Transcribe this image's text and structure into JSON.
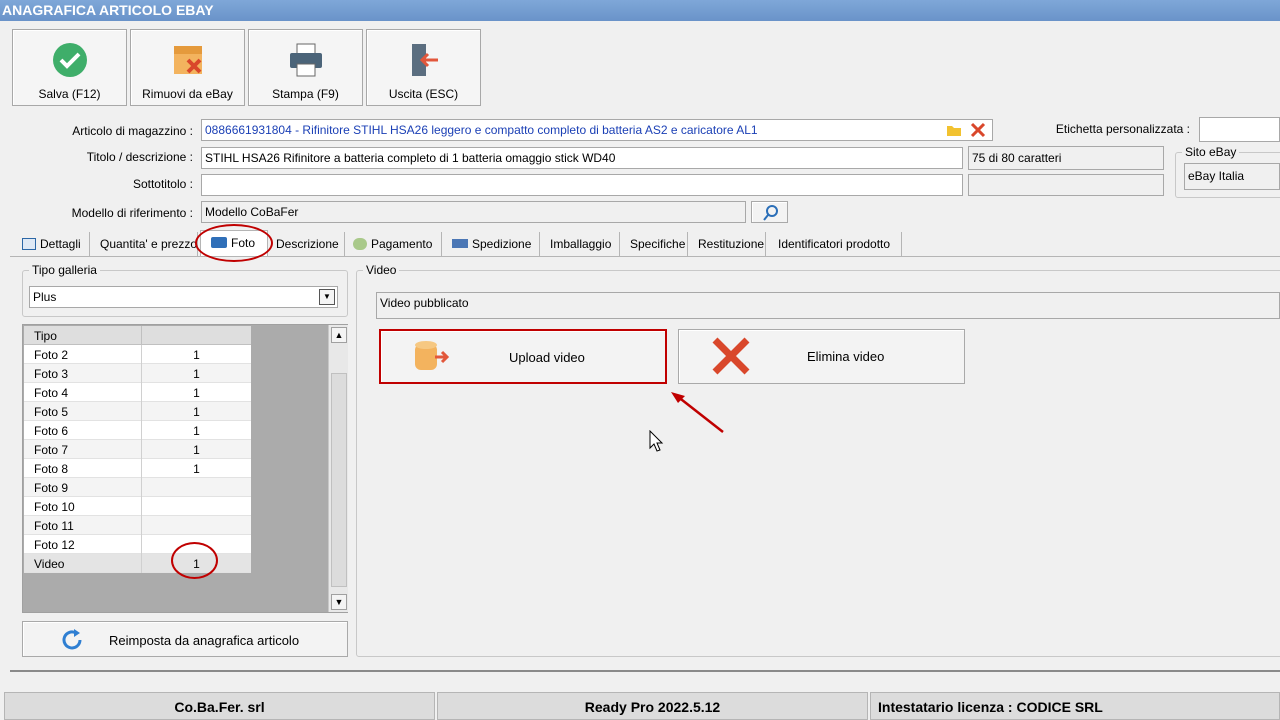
{
  "window": {
    "title": "ANAGRAFICA ARTICOLO EBAY"
  },
  "toolbar": {
    "save": "Salva (F12)",
    "remove": "Rimuovi da eBay",
    "print": "Stampa (F9)",
    "exit": "Uscita (ESC)"
  },
  "form": {
    "articolo_label": "Articolo di magazzino :",
    "articolo_value": "0886661931804 - Rifinitore STIHL HSA26 leggero e compatto completo di batteria AS2 e caricatore AL1",
    "titolo_label": "Titolo / descrizione :",
    "titolo_value": "STIHL HSA26 Rifinitore a batteria completo di 1 batteria omaggio stick WD40",
    "char_count": "75 di 80 caratteri",
    "sottotitolo_label": "Sottotitolo :",
    "sottotitolo_value": "",
    "modello_label": "Modello di riferimento :",
    "modello_value": "Modello CoBaFer",
    "etichetta_label": "Etichetta personalizzata :",
    "etichetta_value": "",
    "sito_label": "Sito eBay",
    "sito_value": "eBay Italia"
  },
  "tabs": [
    "Dettagli",
    "Quantita' e prezzo",
    "Foto",
    "Descrizione",
    "Pagamento",
    "Spedizione",
    "Imballaggio",
    "Specifiche",
    "Restituzione",
    "Identificatori prodotto"
  ],
  "gallery": {
    "group_title": "Tipo galleria",
    "selected": "Plus",
    "grid_header": "Tipo",
    "rows": [
      {
        "tipo": "Foto 2",
        "val": "1"
      },
      {
        "tipo": "Foto 3",
        "val": "1"
      },
      {
        "tipo": "Foto 4",
        "val": "1"
      },
      {
        "tipo": "Foto 5",
        "val": "1"
      },
      {
        "tipo": "Foto 6",
        "val": "1"
      },
      {
        "tipo": "Foto 7",
        "val": "1"
      },
      {
        "tipo": "Foto 8",
        "val": "1"
      },
      {
        "tipo": "Foto 9",
        "val": ""
      },
      {
        "tipo": "Foto 10",
        "val": ""
      },
      {
        "tipo": "Foto 11",
        "val": ""
      },
      {
        "tipo": "Foto 12",
        "val": ""
      },
      {
        "tipo": "Video",
        "val": "1"
      }
    ],
    "reset_button": "Reimposta da anagrafica articolo"
  },
  "video": {
    "group_title": "Video",
    "status": "Video pubblicato",
    "upload": "Upload video",
    "delete": "Elimina video"
  },
  "statusbar": {
    "company": "Co.Ba.Fer. srl",
    "version": "Ready Pro 2022.5.12",
    "license": "Intestatario licenza : CODICE SRL"
  },
  "colors": {
    "accent_red": "#c00000",
    "link_blue": "#1a3fb5",
    "titlebar": "#7fa7d8"
  }
}
